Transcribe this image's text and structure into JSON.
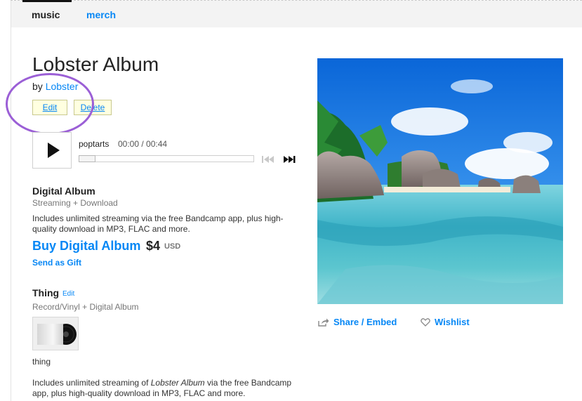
{
  "nav": {
    "music": "music",
    "merch": "merch"
  },
  "album": {
    "title": "Lobster Album",
    "by_prefix": "by",
    "artist": "Lobster"
  },
  "admin": {
    "edit": "Edit",
    "delete": "Delete"
  },
  "player": {
    "track": "poptarts",
    "time": "00:00 / 00:44",
    "progress": 0
  },
  "digital": {
    "heading": "Digital Album",
    "sub": "Streaming + Download",
    "desc": "Includes unlimited streaming via the free Bandcamp app, plus high-quality download in MP3, FLAC and more.",
    "buy": "Buy Digital Album",
    "price": "$4",
    "currency": "USD",
    "gift": "Send as Gift"
  },
  "thing": {
    "heading": "Thing",
    "edit": "Edit",
    "sub": "Record/Vinyl + Digital Album",
    "caption": "thing",
    "desc_before": "Includes unlimited streaming of ",
    "desc_album": "Lobster Album",
    "desc_after": " via the free Bandcamp app, plus high-quality download in MP3, FLAC and more."
  },
  "actions": {
    "share": "Share / Embed",
    "wishlist": "Wishlist"
  },
  "colors": {
    "link": "#0687f5",
    "annotation": "#9b5fd6",
    "admin_bg": "#ffffe0"
  },
  "icons": [
    "play-icon",
    "prev-track-icon",
    "next-track-icon",
    "share-icon",
    "heart-icon"
  ]
}
